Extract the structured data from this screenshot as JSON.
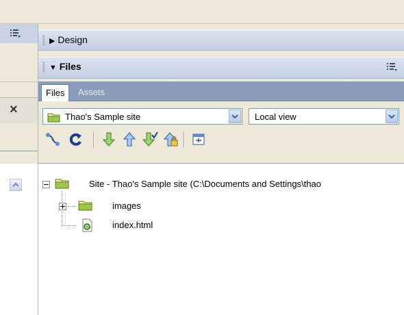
{
  "panels": {
    "design": {
      "title": "Design",
      "expanded": false
    },
    "files": {
      "title": "Files",
      "expanded": true
    }
  },
  "tabs": [
    {
      "label": "Files",
      "active": true
    },
    {
      "label": "Assets",
      "active": false
    }
  ],
  "site_select": {
    "value": "Thao's Sample site"
  },
  "view_select": {
    "value": "Local view"
  },
  "toolbar": {
    "buttons": [
      "connect-icon",
      "refresh-icon",
      "get-files-icon",
      "put-files-icon",
      "check-out-icon",
      "check-in-icon",
      "expand-icon"
    ]
  },
  "tree": {
    "root": {
      "label": "Site - Thao's Sample site (C:\\Documents and Settings\\thao"
    },
    "children": [
      {
        "label": "images",
        "type": "folder"
      },
      {
        "label": "index.html",
        "type": "file"
      }
    ]
  },
  "left_panel": {
    "close_glyph": "×"
  },
  "colors": {
    "panel_header": "#c9d3e3",
    "tab_strip": "#8b9bbb",
    "folder": "#7aa532"
  }
}
